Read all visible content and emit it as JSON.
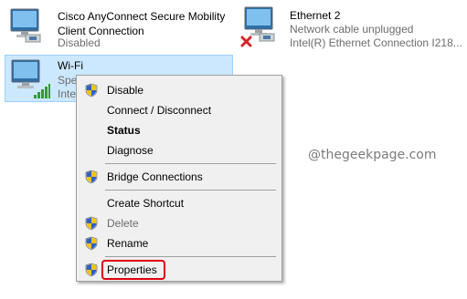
{
  "adapters": {
    "cisco": {
      "name_line1": "Cisco AnyConnect Secure Mobility",
      "name_line2": "Client Connection",
      "status": "Disabled",
      "icon": "network-adapter-icon"
    },
    "ethernet": {
      "name": "Ethernet 2",
      "status": "Network cable unplugged",
      "device": "Intel(R) Ethernet Connection I218...",
      "icon": "network-adapter-disconnected-icon"
    },
    "wifi": {
      "name": "Wi-Fi",
      "status": "Spe",
      "device": "Inte",
      "icon": "wifi-signal-adapter-icon"
    }
  },
  "context_menu": {
    "items": [
      {
        "label": "Disable",
        "shield": true
      },
      {
        "label": "Connect / Disconnect",
        "shield": false
      },
      {
        "label": "Status",
        "shield": false,
        "bold": true
      },
      {
        "label": "Diagnose",
        "shield": false
      },
      {
        "label": "Bridge Connections",
        "shield": true
      },
      {
        "label": "Create Shortcut",
        "shield": false
      },
      {
        "label": "Delete",
        "shield": true,
        "disabled": true
      },
      {
        "label": "Rename",
        "shield": true
      },
      {
        "label": "Properties",
        "shield": true,
        "highlighted": true
      }
    ]
  },
  "watermark": "@thegeekpage.com",
  "colors": {
    "selection_bg": "#cce8ff",
    "selection_border": "#99d1ff",
    "menu_bg": "#f0f0f0",
    "highlight_box": "#e0000e",
    "secondary_text": "#6d6d6d"
  }
}
